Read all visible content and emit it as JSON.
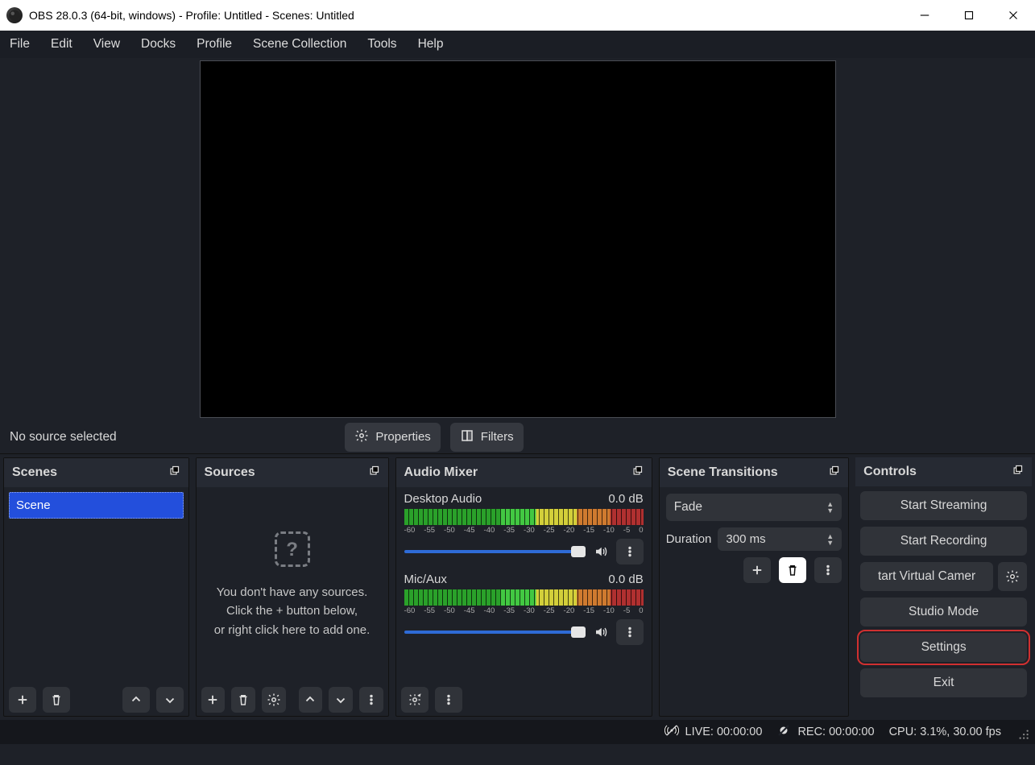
{
  "titlebar": {
    "title": "OBS 28.0.3 (64-bit, windows) - Profile: Untitled - Scenes: Untitled"
  },
  "menu": {
    "items": [
      "File",
      "Edit",
      "View",
      "Docks",
      "Profile",
      "Scene Collection",
      "Tools",
      "Help"
    ]
  },
  "underpreview": {
    "no_source": "No source selected",
    "properties": "Properties",
    "filters": "Filters"
  },
  "docks": {
    "scenes": {
      "title": "Scenes",
      "items": [
        "Scene"
      ]
    },
    "sources": {
      "title": "Sources",
      "empty1": "You don't have any sources.",
      "empty2": "Click the + button below,",
      "empty3": "or right click here to add one."
    },
    "mixer": {
      "title": "Audio Mixer",
      "channels": [
        {
          "name": "Desktop Audio",
          "level": "0.0 dB"
        },
        {
          "name": "Mic/Aux",
          "level": "0.0 dB"
        }
      ],
      "ticks": [
        "-60",
        "-55",
        "-50",
        "-45",
        "-40",
        "-35",
        "-30",
        "-25",
        "-20",
        "-15",
        "-10",
        "-5",
        "0"
      ]
    },
    "transitions": {
      "title": "Scene Transitions",
      "select": "Fade",
      "duration_label": "Duration",
      "duration_value": "300 ms"
    },
    "controls": {
      "title": "Controls",
      "start_streaming": "Start Streaming",
      "start_recording": "Start Recording",
      "virtual_cam": "tart Virtual Camer",
      "studio_mode": "Studio Mode",
      "settings": "Settings",
      "exit": "Exit"
    }
  },
  "status": {
    "live": "LIVE: 00:00:00",
    "rec": "REC: 00:00:00",
    "cpu": "CPU: 3.1%, 30.00 fps"
  }
}
